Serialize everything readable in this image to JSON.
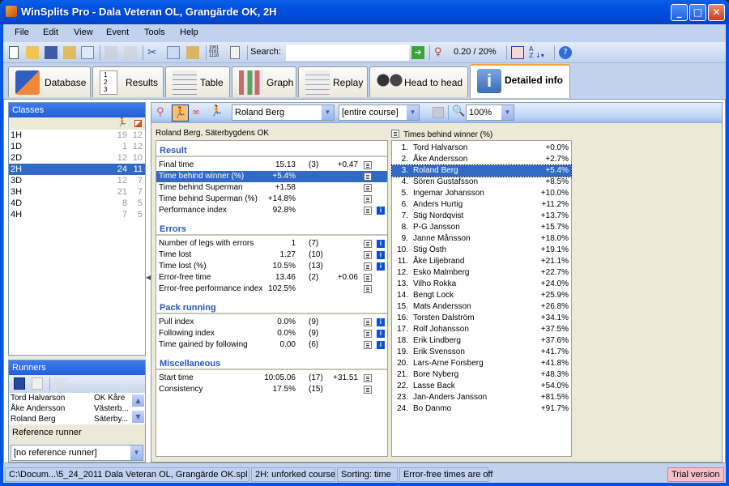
{
  "window": {
    "title": "WinSplits Pro - Dala Veteran OL, Grangärde OK, 2H",
    "controls": {
      "minimize": "_",
      "maximize": "□",
      "close": "✕"
    }
  },
  "menu": [
    "File",
    "Edit",
    "View",
    "Event",
    "Tools",
    "Help"
  ],
  "toolbar": {
    "icons": [
      "new-icon",
      "open-icon",
      "save-icon",
      "export-icon",
      "document-icon",
      "print-icon",
      "print-preview-icon",
      "cut-icon",
      "copy-icon",
      "paste-icon",
      "binary-icon",
      "list-icon"
    ],
    "search_label": "Search:",
    "search_value": "",
    "ratio_text": "0.20 / 20%",
    "sort_label": "A Z"
  },
  "tabs": [
    {
      "label": "Database",
      "icon": "database-icon"
    },
    {
      "label": "Results",
      "icon": "results-icon"
    },
    {
      "label": "Table",
      "icon": "table-icon"
    },
    {
      "label": "Graph",
      "icon": "graph-icon"
    },
    {
      "label": "Replay",
      "icon": "replay-icon"
    },
    {
      "label": "Head to head",
      "icon": "head-to-head-icon"
    },
    {
      "label": "Detailed info",
      "icon": "info-icon",
      "active": true
    }
  ],
  "classes": {
    "title": "Classes",
    "rows": [
      {
        "name": "1H",
        "runners": "19",
        "controls": "12"
      },
      {
        "name": "1D",
        "runners": "1",
        "controls": "12"
      },
      {
        "name": "2D",
        "runners": "12",
        "controls": "10"
      },
      {
        "name": "2H",
        "runners": "24",
        "controls": "11",
        "selected": true
      },
      {
        "name": "3D",
        "runners": "12",
        "controls": "7"
      },
      {
        "name": "3H",
        "runners": "21",
        "controls": "7"
      },
      {
        "name": "4D",
        "runners": "8",
        "controls": "5"
      },
      {
        "name": "4H",
        "runners": "7",
        "controls": "5"
      }
    ]
  },
  "runners": {
    "title": "Runners",
    "rows": [
      {
        "name": "Tord Halvarson",
        "club": "OK Kåre"
      },
      {
        "name": "Åke Andersson",
        "club": "Västerb..."
      },
      {
        "name": "Roland Berg",
        "club": "Säterby..."
      }
    ],
    "reference_label": "Reference runner",
    "reference_value": "[no reference runner]"
  },
  "detail_toolbar": {
    "runner_select": "Roland Berg",
    "course_select": "[entire course]",
    "zoom_select": "100%"
  },
  "runner_caption": "Roland Berg, Säterbygdens OK",
  "sections": [
    {
      "title": "Result",
      "rows": [
        {
          "label": "Final time",
          "value": "15.13",
          "rank": "(3)",
          "diff": "+0.47",
          "info": false
        },
        {
          "label": "Time behind winner (%)",
          "value": "+5.4%",
          "rank": "",
          "diff": "",
          "info": false,
          "selected": true
        },
        {
          "label": "Time behind Superman",
          "value": "+1.58",
          "rank": "",
          "diff": "",
          "info": false
        },
        {
          "label": "Time behind Superman (%)",
          "value": "+14.8%",
          "rank": "",
          "diff": "",
          "info": false
        },
        {
          "label": "Performance index",
          "value": "92.8%",
          "rank": "",
          "diff": "",
          "info": true
        }
      ]
    },
    {
      "title": "Errors",
      "rows": [
        {
          "label": "Number of legs with errors",
          "value": "1",
          "rank": "(7)",
          "diff": "",
          "info": true
        },
        {
          "label": "Time lost",
          "value": "1.27",
          "rank": "(10)",
          "diff": "",
          "info": true
        },
        {
          "label": "Time lost (%)",
          "value": "10.5%",
          "rank": "(13)",
          "diff": "",
          "info": true
        },
        {
          "label": "Error-free time",
          "value": "13.46",
          "rank": "(2)",
          "diff": "+0.06",
          "info": false
        },
        {
          "label": "Error-free performance index",
          "value": "102.5%",
          "rank": "",
          "diff": "",
          "info": false
        }
      ]
    },
    {
      "title": "Pack running",
      "rows": [
        {
          "label": "Pull index",
          "value": "0.0%",
          "rank": "(9)",
          "diff": "",
          "info": true
        },
        {
          "label": "Following index",
          "value": "0.0%",
          "rank": "(9)",
          "diff": "",
          "info": true
        },
        {
          "label": "Time gained by following",
          "value": "0.00",
          "rank": "(6)",
          "diff": "",
          "info": true
        }
      ]
    },
    {
      "title": "Miscellaneous",
      "rows": [
        {
          "label": "Start time",
          "value": "10:05.06",
          "rank": "(17)",
          "diff": "+31.51",
          "info": false
        },
        {
          "label": "Consistency",
          "value": "17.5%",
          "rank": "(15)",
          "diff": "",
          "info": false
        }
      ]
    }
  ],
  "list": {
    "caption": "Times behind winner (%)",
    "rows": [
      {
        "pos": "1.",
        "name": "Tord Halvarson",
        "pct": "+0.0%"
      },
      {
        "pos": "2.",
        "name": "Åke Andersson",
        "pct": "+2.7%"
      },
      {
        "pos": "3.",
        "name": "Roland Berg",
        "pct": "+5.4%",
        "selected": true
      },
      {
        "pos": "4.",
        "name": "Sören Gustafsson",
        "pct": "+8.5%"
      },
      {
        "pos": "5.",
        "name": "Ingemar Johansson",
        "pct": "+10.0%"
      },
      {
        "pos": "6.",
        "name": "Anders Hurtig",
        "pct": "+11.2%"
      },
      {
        "pos": "7.",
        "name": "Stig Nordqvist",
        "pct": "+13.7%"
      },
      {
        "pos": "8.",
        "name": "P-G Jansson",
        "pct": "+15.7%"
      },
      {
        "pos": "9.",
        "name": "Janne Månsson",
        "pct": "+18.0%"
      },
      {
        "pos": "10.",
        "name": "Stig Östh",
        "pct": "+19.1%"
      },
      {
        "pos": "11.",
        "name": "Åke Liljebrand",
        "pct": "+21.1%"
      },
      {
        "pos": "12.",
        "name": "Esko Malmberg",
        "pct": "+22.7%"
      },
      {
        "pos": "13.",
        "name": "Vilho Rokka",
        "pct": "+24.0%"
      },
      {
        "pos": "14.",
        "name": "Bengt Lock",
        "pct": "+25.9%"
      },
      {
        "pos": "15.",
        "name": "Mats Andersson",
        "pct": "+26.8%"
      },
      {
        "pos": "16.",
        "name": "Torsten Dalström",
        "pct": "+34.1%"
      },
      {
        "pos": "17.",
        "name": "Rolf Johansson",
        "pct": "+37.5%"
      },
      {
        "pos": "18.",
        "name": "Erik Lindberg",
        "pct": "+37.6%"
      },
      {
        "pos": "19.",
        "name": "Erik Svensson",
        "pct": "+41.7%"
      },
      {
        "pos": "20.",
        "name": "Lars-Arne Forsberg",
        "pct": "+41.8%"
      },
      {
        "pos": "21.",
        "name": "Bore Nyberg",
        "pct": "+48.3%"
      },
      {
        "pos": "22.",
        "name": "Lasse Back",
        "pct": "+54.0%"
      },
      {
        "pos": "23.",
        "name": "Jan-Anders Jansson",
        "pct": "+81.5%"
      },
      {
        "pos": "24.",
        "name": "Bo Danmo",
        "pct": "+91.7%"
      }
    ]
  },
  "status": {
    "file": "C:\\Docum...\\5_24_2011 Dala Veteran OL, Grangärde OK.spl",
    "course": "2H: unforked course",
    "sorting": "Sorting: time",
    "errorfree": "Error-free times are off",
    "trial": "Trial version"
  },
  "colors": {
    "selection": "#316ac5",
    "section_title": "#2957b9",
    "trial_bg": "#f7c0c8"
  }
}
